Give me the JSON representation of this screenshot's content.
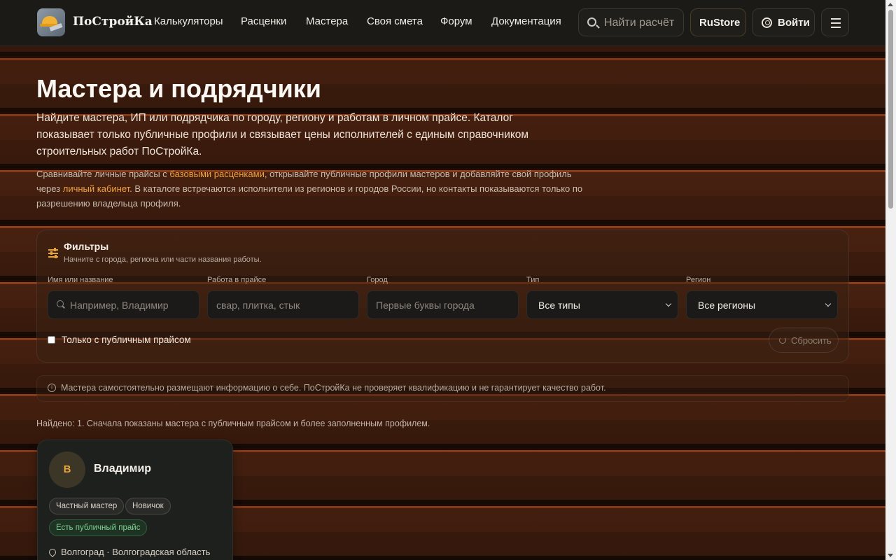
{
  "brand": {
    "name": "ПоСтройКа"
  },
  "nav": [
    {
      "label": "Калькуляторы"
    },
    {
      "label": "Расценки"
    },
    {
      "label": "Мастера"
    },
    {
      "label": "Своя смета"
    },
    {
      "label": "Форум"
    },
    {
      "label": "Документация"
    }
  ],
  "header": {
    "search_placeholder": "Найти расчёт",
    "rustore_label": "RuStore",
    "login_label": "Войти"
  },
  "hero": {
    "title": "Мастера и подрядчики",
    "lead": "Найдите мастера, ИП или подрядчика по городу, региону и работам в личном прайсе. Каталог показывает только публичные профили и связывает цены исполнителей с единым справочником строительных работ ПоСтройКа.",
    "note_part1": "Сравнивайте личные прайсы с ",
    "note_link1": "базовыми расценками",
    "note_part2": ", открывайте публичные профили мастеров и добавляйте свой профиль через ",
    "note_link2": "личный кабинет",
    "note_part3": ". В каталоге встречаются исполнители из регионов и городов России, но контакты показываются только по разрешению владельца профиля."
  },
  "filters": {
    "title": "Фильтры",
    "subtitle": "Начните с города, региона или части названия работы.",
    "fields": [
      {
        "label": "Имя или название",
        "placeholder": "Например, Владимир"
      },
      {
        "label": "Работа в прайсе",
        "placeholder": "свар, плитка, стык"
      },
      {
        "label": "Город",
        "placeholder": "Первые буквы города"
      },
      {
        "label": "Тип",
        "value": "Все типы"
      },
      {
        "label": "Регион",
        "value": "Все регионы"
      }
    ],
    "public_price_only": "Только с публичным прайсом",
    "reset_label": "Сбросить"
  },
  "notice": "Мастера самостоятельно размещают информацию о себе. ПоСтройКа не проверяет квалификацию и не гарантирует качество работ.",
  "found": "Найдено: 1. Сначала показаны мастера с публичным прайсом и более заполненным профилем.",
  "cards": [
    {
      "initial": "В",
      "name": "Владимир",
      "tags": [
        "Частный мастер",
        "Новичок"
      ],
      "badge": "Есть публичный прайс",
      "location": "Волгоград · Волгоградская область"
    }
  ]
}
